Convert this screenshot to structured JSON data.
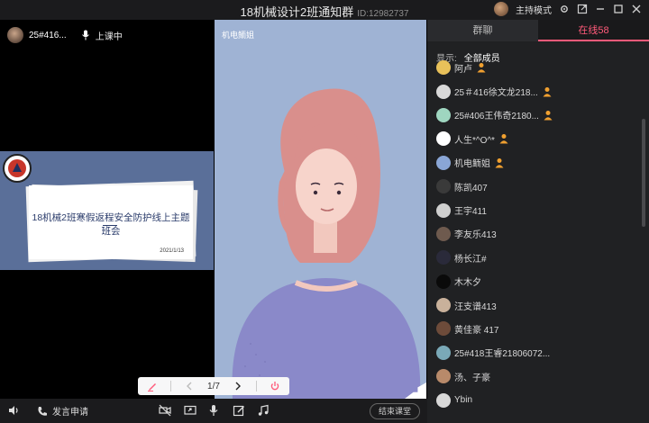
{
  "window": {
    "title": "18机械设计2班通知群",
    "group_id": "ID:12982737",
    "mode_label": "主持模式"
  },
  "teacher": {
    "name": "25#416...",
    "status": "上课中"
  },
  "slide": {
    "title": "18机械2班寒假返程安全防护线上主题班会",
    "date": "2021/1/13"
  },
  "presenter_pane": {
    "label": "机电鲕姐"
  },
  "sidebar": {
    "tabs": [
      "群聊",
      "在线58"
    ],
    "filter_label": "显示:",
    "filter_value": "全部成员",
    "members": [
      {
        "name": "阿卢",
        "badge": true,
        "avatar_color": "#e8c15a"
      },
      {
        "name": "25＃416徐文龙218...",
        "badge": true,
        "avatar_color": "#d9d9d9"
      },
      {
        "name": "25#406王伟奇2180...",
        "badge": true,
        "avatar_color": "#9fd6c0"
      },
      {
        "name": "人生*^O^*",
        "badge": true,
        "avatar_color": "#ffffff"
      },
      {
        "name": "机电鲕姐",
        "badge": true,
        "avatar_color": "#8aa6d6"
      },
      {
        "name": "陈凯407",
        "badge": false,
        "avatar_color": "#3a3a3a"
      },
      {
        "name": "王宇411",
        "badge": false,
        "avatar_color": "#cfcfcf"
      },
      {
        "name": "李友乐413",
        "badge": false,
        "avatar_color": "#6e5a4e"
      },
      {
        "name": "杨长江#",
        "badge": false,
        "avatar_color": "#2a2a3a"
      },
      {
        "name": "木木夕",
        "badge": false,
        "avatar_color": "#0a0a0a"
      },
      {
        "name": "汪支谱413",
        "badge": false,
        "avatar_color": "#c9b19b"
      },
      {
        "name": "黄佳豪 417",
        "badge": false,
        "avatar_color": "#6d4b3a"
      },
      {
        "name": "25#418王睿21806072...",
        "badge": false,
        "avatar_color": "#7aa9b8"
      },
      {
        "name": "汤、子豪",
        "badge": false,
        "avatar_color": "#b88a6a"
      },
      {
        "name": "Ybin",
        "badge": false,
        "avatar_color": "#d8d8d8"
      }
    ]
  },
  "bottombar": {
    "raise_hand_label": "发言申请",
    "end_class_label": "结束课堂"
  },
  "pagebar": {
    "page_indicator": "1/7"
  },
  "colors": {
    "accent": "#ff5a7a",
    "slide_bg": "#5a6f99",
    "avatar_bg": "#9fb3d4",
    "badge": "#f0a030"
  }
}
